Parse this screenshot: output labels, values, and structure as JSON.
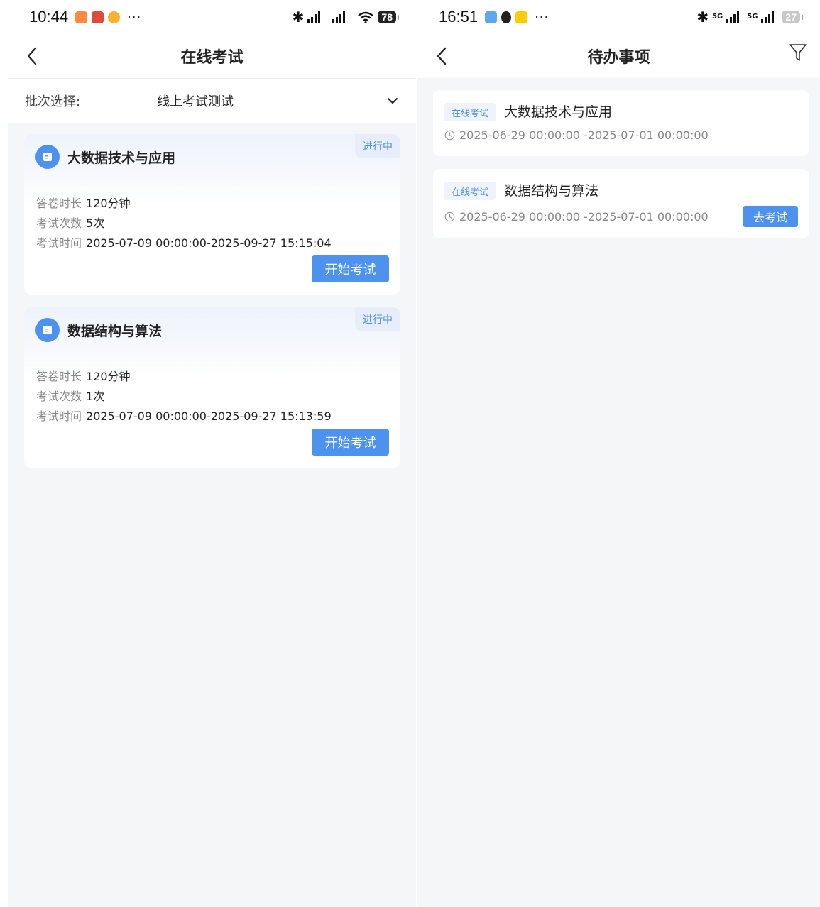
{
  "left": {
    "status": {
      "time": "10:44",
      "battery": "78"
    },
    "nav": {
      "title": "在线考试"
    },
    "batch": {
      "label": "批次选择:",
      "value": "线上考试测试"
    },
    "exams": [
      {
        "title": "大数据技术与应用",
        "status": "进行中",
        "duration_label": "答卷时长",
        "duration": "120分钟",
        "attempts_label": "考试次数",
        "attempts": "5次",
        "time_label": "考试时间",
        "time": "2025-07-09 00:00:00-2025-09-27 15:15:04",
        "button": "开始考试"
      },
      {
        "title": "数据结构与算法",
        "status": "进行中",
        "duration_label": "答卷时长",
        "duration": "120分钟",
        "attempts_label": "考试次数",
        "attempts": "1次",
        "time_label": "考试时间",
        "time": "2025-07-09 00:00:00-2025-09-27 15:13:59",
        "button": "开始考试"
      }
    ]
  },
  "right": {
    "status": {
      "time": "16:51",
      "network": "5G",
      "battery": "27"
    },
    "nav": {
      "title": "待办事项"
    },
    "todos": [
      {
        "tag": "在线考试",
        "title": "大数据技术与应用",
        "time": "2025-06-29 00:00:00 -2025-07-01 00:00:00"
      },
      {
        "tag": "在线考试",
        "title": "数据结构与算法",
        "time": "2025-06-29 00:00:00 -2025-07-01 00:00:00",
        "button": "去考试"
      }
    ]
  },
  "icons": {
    "back": "chevron-left-icon",
    "dropdown": "chevron-down-icon",
    "filter": "filter-icon",
    "clock": "clock-icon",
    "exam": "book-icon"
  },
  "colors": {
    "accent": "#4d92ee",
    "tag_bg": "#eef3fc",
    "page_bg": "#f5f6f8"
  }
}
